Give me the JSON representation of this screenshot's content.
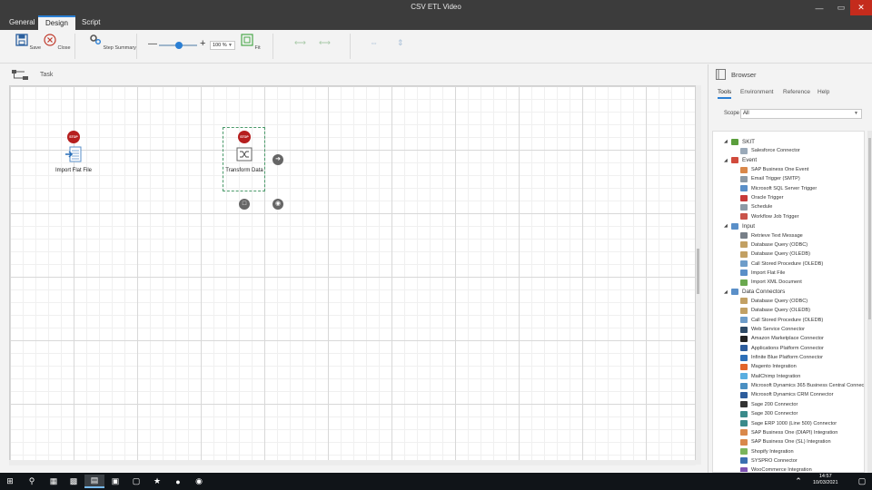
{
  "window": {
    "title": "CSV ETL Video"
  },
  "tabs": [
    "General",
    "Design",
    "Script"
  ],
  "ribbon": {
    "save_label": "Save",
    "close_label": "Close",
    "step_summary_label": "Step Summary",
    "zoom_value": "100 %",
    "zoom_fraction": 0.5,
    "fit_label": "Fit"
  },
  "task": {
    "label": "Task"
  },
  "canvas": {
    "nodes": [
      {
        "label": "Import Flat File",
        "stop": "STOP"
      },
      {
        "label": "Transform Data",
        "stop": "STOP"
      }
    ]
  },
  "browser": {
    "title": "Browser",
    "tabs": [
      "Tools",
      "Environment",
      "Reference",
      "Help"
    ],
    "scope_label": "Scope",
    "scope_value": "All",
    "tree": [
      {
        "type": "cat",
        "label": "SKIT",
        "color": "#5a9e3c"
      },
      {
        "type": "item",
        "label": "Salesforce Connector",
        "color": "#9aa9b8"
      },
      {
        "type": "cat",
        "label": "Event",
        "color": "#d14b3c"
      },
      {
        "type": "item",
        "label": "SAP Business One Event",
        "color": "#d9884a"
      },
      {
        "type": "item",
        "label": "Email Trigger (SMTP)",
        "color": "#8d9aa6"
      },
      {
        "type": "item",
        "label": "Microsoft SQL Server Trigger",
        "color": "#5a8fc8"
      },
      {
        "type": "item",
        "label": "Oracle Trigger",
        "color": "#c73a3a"
      },
      {
        "type": "item",
        "label": "Schedule",
        "color": "#8d9aa6"
      },
      {
        "type": "item",
        "label": "Workflow Job Trigger",
        "color": "#c9534a"
      },
      {
        "type": "cat",
        "label": "Input",
        "color": "#5a8fc8"
      },
      {
        "type": "item",
        "label": "Retrieve Text Message",
        "color": "#777f88"
      },
      {
        "type": "item",
        "label": "Database Query (ODBC)",
        "color": "#c2a063"
      },
      {
        "type": "item",
        "label": "Database Query (OLEDB)",
        "color": "#c2a063"
      },
      {
        "type": "item",
        "label": "Call Stored Procedure (OLEDB)",
        "color": "#6d9cc9"
      },
      {
        "type": "item",
        "label": "Import Flat File",
        "color": "#5a8fc8"
      },
      {
        "type": "item",
        "label": "Import XML Document",
        "color": "#6aa84f"
      },
      {
        "type": "cat",
        "label": "Data Connectors",
        "color": "#5a8fc8"
      },
      {
        "type": "item",
        "label": "Database Query (ODBC)",
        "color": "#c2a063"
      },
      {
        "type": "item",
        "label": "Database Query (OLEDB)",
        "color": "#c2a063"
      },
      {
        "type": "item",
        "label": "Call Stored Procedure (OLEDB)",
        "color": "#6d9cc9"
      },
      {
        "type": "item",
        "label": "Web Service Connector",
        "color": "#2e4a66"
      },
      {
        "type": "item",
        "label": "Amazon Marketplace Connector",
        "color": "#222222"
      },
      {
        "type": "item",
        "label": "Applications Platform Connector",
        "color": "#2d5d9c"
      },
      {
        "type": "item",
        "label": "Infinite Blue Platform Connector",
        "color": "#2d6fb8"
      },
      {
        "type": "item",
        "label": "Magento Integration",
        "color": "#e2652b"
      },
      {
        "type": "item",
        "label": "MailChimp Integration",
        "color": "#5aaee0"
      },
      {
        "type": "item",
        "label": "Microsoft Dynamics 365 Business Central Connector",
        "color": "#4a8fc2"
      },
      {
        "type": "item",
        "label": "Microsoft Dynamics CRM Connector",
        "color": "#2d5d9c"
      },
      {
        "type": "item",
        "label": "Sage 200 Connector",
        "color": "#333333"
      },
      {
        "type": "item",
        "label": "Sage 300 Connector",
        "color": "#3a8a8a"
      },
      {
        "type": "item",
        "label": "Sage ERP 1000 (Line 500) Connector",
        "color": "#3a8a8a"
      },
      {
        "type": "item",
        "label": "SAP Business One (DIAPI) Integration",
        "color": "#d9884a"
      },
      {
        "type": "item",
        "label": "SAP Business One (SL) Integration",
        "color": "#d9884a"
      },
      {
        "type": "item",
        "label": "Shopify Integration",
        "color": "#7ab55c"
      },
      {
        "type": "item",
        "label": "SYSPRO Connector",
        "color": "#3a6fb0"
      },
      {
        "type": "item",
        "label": "WooCommerce Integration",
        "color": "#7f54b3"
      }
    ]
  },
  "system": {
    "time": "14:57",
    "date": "10/03/2021"
  },
  "colors": {
    "accent": "#2a7fd4",
    "titlebar": "#3c3c3c",
    "stop": "#b61f1f"
  }
}
